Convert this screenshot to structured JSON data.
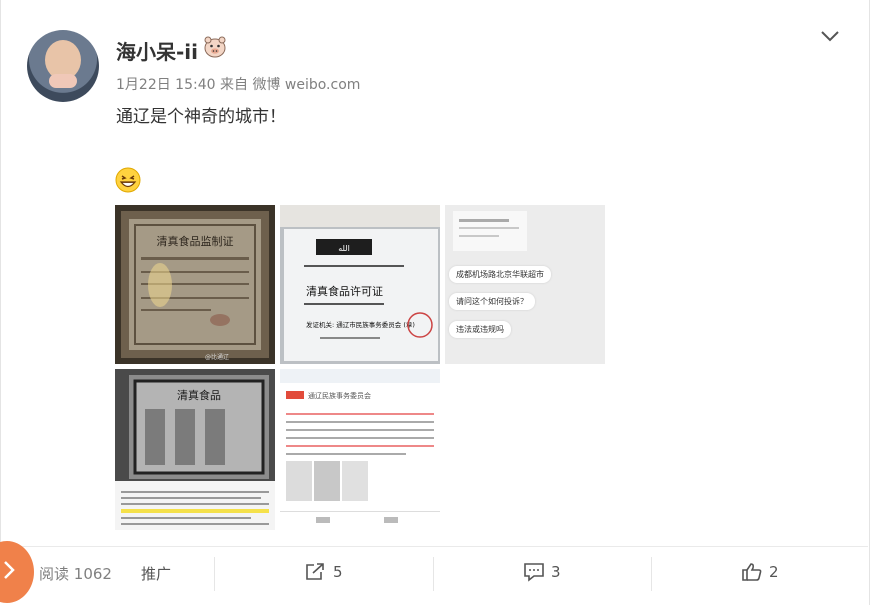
{
  "user": {
    "name": "海小呆-ii",
    "avatar_icon": "baby-avatar",
    "badge_icon": "piglet-badge-icon"
  },
  "meta": {
    "date": "1月22日 15:40",
    "source_prefix": "来自",
    "source": "微博 weibo.com"
  },
  "post": {
    "text": "通辽是个神奇的城市！",
    "emoji": "grinning-face-icon",
    "images": [
      {
        "caption": "清真食品监制证",
        "watermark": "@比通辽"
      },
      {
        "caption": "清真食品许可证",
        "subcaption": "发证机关: 通辽市民族事务委员会 (章)"
      },
      {
        "messages": [
          "成都机场路北京华联超市",
          "请问这个如何投诉？",
          "违法或违规吗"
        ]
      },
      {
        "caption": "清真食品"
      },
      {
        "caption": "通辽民族事务委员会"
      }
    ]
  },
  "footer": {
    "read_label": "阅读",
    "read_count": "1062",
    "promote_label": "推广",
    "repost_count": "5",
    "comment_count": "3",
    "like_count": "2"
  },
  "colors": {
    "accent": "#f0814a",
    "text": "#333333",
    "muted": "#808080"
  }
}
